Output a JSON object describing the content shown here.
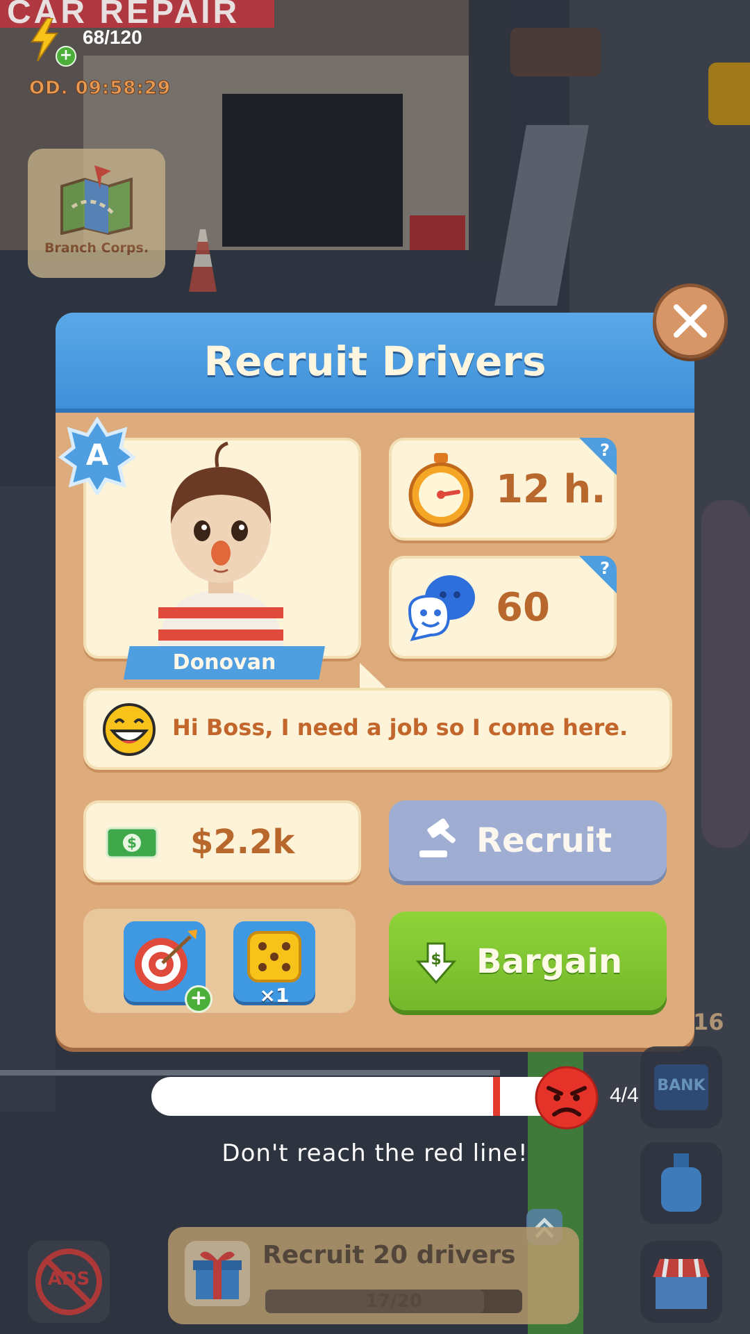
{
  "hud": {
    "energy": "68/120",
    "timer": "OD. 09:58:29",
    "branch_label": "Branch Corps."
  },
  "dialog": {
    "title": "Recruit Drivers",
    "rank": "A",
    "driver_name": "Donovan",
    "stats": {
      "time_value": "12 h.",
      "mood_value": "60",
      "help_mark": "?"
    },
    "speech": "Hi Boss, I need a job so I come here.",
    "price": "$2.2k",
    "recruit_label": "Recruit",
    "bargain_label": "Bargain",
    "dice_count": "×1"
  },
  "progress": {
    "level": 0.78,
    "count": "4/4",
    "warning": "Don't reach the red line!"
  },
  "quest": {
    "title": "Recruit 20 drivers",
    "progress": "17/20",
    "fraction": 0.85
  },
  "side": {
    "bank_label": "BANK",
    "number": "16"
  },
  "ads_label": "ADS",
  "background": {
    "sign_text": "CAR REPAIR"
  }
}
